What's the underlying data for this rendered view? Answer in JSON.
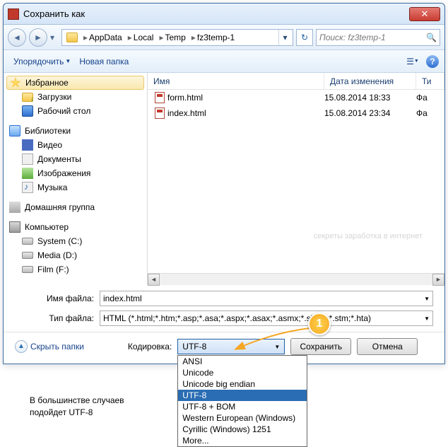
{
  "window": {
    "title": "Сохранить как"
  },
  "nav": {
    "crumbs": [
      "AppData",
      "Local",
      "Temp",
      "fz3temp-1"
    ],
    "search_placeholder": "Поиск: fz3temp-1"
  },
  "toolbar": {
    "organize": "Упорядочить",
    "newfolder": "Новая папка"
  },
  "sidebar": {
    "favorites": {
      "label": "Избранное",
      "items": [
        "Загрузки",
        "Рабочий стол"
      ]
    },
    "libraries": {
      "label": "Библиотеки",
      "items": [
        "Видео",
        "Документы",
        "Изображения",
        "Музыка"
      ]
    },
    "homegroup": {
      "label": "Домашняя группа"
    },
    "computer": {
      "label": "Компьютер",
      "items": [
        "System (C:)",
        "Media (D:)",
        "Film (F:)"
      ]
    }
  },
  "columns": {
    "name": "Имя",
    "date": "Дата изменения",
    "type": "Ти"
  },
  "files": [
    {
      "name": "form.html",
      "date": "15.08.2014 18:33",
      "type": "Фа"
    },
    {
      "name": "index.html",
      "date": "15.08.2014 23:34",
      "type": "Фа"
    }
  ],
  "fields": {
    "filename_label": "Имя файла:",
    "filename_value": "index.html",
    "filetype_label": "Тип файла:",
    "filetype_value": "HTML (*.html;*.htm;*.asp;*.asa;*.aspx;*.asax;*.asmx;*.shtml;*.stm;*.hta)"
  },
  "bottom": {
    "hide": "Скрыть папки",
    "encoding_label": "Кодировка:",
    "encoding_value": "UTF-8",
    "encoding_options": [
      "ANSI",
      "Unicode",
      "Unicode big endian",
      "UTF-8",
      "UTF-8 + BOM",
      "Western European (Windows)",
      "Cyrillic (Windows) 1251",
      "More..."
    ],
    "save": "Сохранить",
    "cancel": "Отмена"
  },
  "watermark": "секреты заработка в интернет",
  "annotation_num": "1",
  "caption_line1": "В большинстве случаев",
  "caption_line2": "подойдет UTF-8"
}
